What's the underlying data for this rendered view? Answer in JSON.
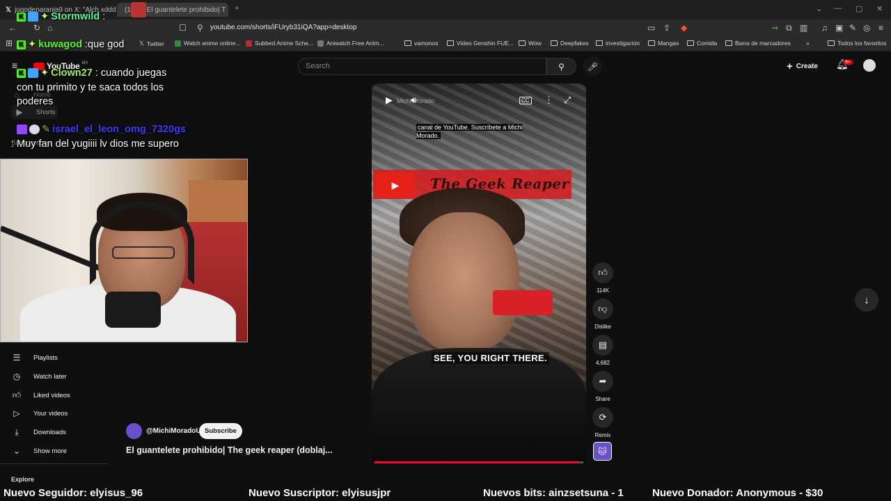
{
  "browser": {
    "tabs": [
      {
        "label": "jugodenaranja9 on X: \"Alch xddd ht",
        "icon": "x-logo-icon"
      },
      {
        "label": "(1093) El guantelete prohibido| T",
        "icon": "youtube-icon"
      }
    ],
    "url": "youtube.com/shorts/iFUryb31iQA?app=desktop",
    "bookmarks": [
      {
        "label": "Twitter",
        "icon": "x-logo-icon"
      },
      {
        "label": "Watch anime online...",
        "icon": "shield-icon"
      },
      {
        "label": "Subbed Anime Sche...",
        "icon": "a-logo-icon"
      },
      {
        "label": "Aniwatch Free Anim...",
        "icon": "aniwatch-icon"
      },
      {
        "label": "vamonos",
        "icon": "folder-icon"
      },
      {
        "label": "Video Genshin FUE...",
        "icon": "folder-icon"
      },
      {
        "label": "Wow",
        "icon": "folder-icon"
      },
      {
        "label": "Deepfakes",
        "icon": "folder-icon"
      },
      {
        "label": "investigación",
        "icon": "folder-icon"
      },
      {
        "label": "Mangas",
        "icon": "folder-icon"
      },
      {
        "label": "Comida",
        "icon": "folder-icon"
      },
      {
        "label": "Barra de marcadores",
        "icon": "folder-icon"
      }
    ],
    "all_bookmarks": "Todos los favoritos"
  },
  "youtube": {
    "logo": "YouTube",
    "region": "MX",
    "search_placeholder": "Search",
    "create_label": "Create",
    "notifications_badge": "9+",
    "sidebar": {
      "top_items": [
        "Home",
        "Shorts",
        "Subscriptions"
      ],
      "items": [
        {
          "label": "Playlists",
          "icon": "playlists-icon"
        },
        {
          "label": "Watch later",
          "icon": "clock-icon"
        },
        {
          "label": "Liked videos",
          "icon": "thumbs-up-icon"
        },
        {
          "label": "Your videos",
          "icon": "play-square-icon"
        },
        {
          "label": "Downloads",
          "icon": "download-icon"
        },
        {
          "label": "Show more",
          "icon": "chevron-down-icon"
        }
      ],
      "explore_heading": "Explore"
    },
    "short": {
      "channel_ghost": "Michi Morado",
      "caption_top": "canal de YouTube. Suscríbete a Michi Morado.",
      "banner_title": "The Geek Reaper",
      "subtitle": "SEE, YOU RIGHT THERE.",
      "progress_fraction": 0.98,
      "channel_handle": "@MichiMoradoU",
      "subscribe_label": "Subscribe",
      "title": "El guantelete prohibido| The geek reaper (doblaj..."
    },
    "actions": [
      {
        "label": "114K",
        "icon": "thumbs-up-icon"
      },
      {
        "label": "Dislike",
        "icon": "thumbs-down-icon"
      },
      {
        "label": "4,682",
        "icon": "comment-icon"
      },
      {
        "label": "Share",
        "icon": "share-icon"
      },
      {
        "label": "Remix",
        "icon": "remix-icon"
      }
    ]
  },
  "stream_overlay": {
    "chat": [
      {
        "name": "Stormwild",
        "message": ":",
        "name_color": "#53fc98"
      },
      {
        "name": "kuwagod",
        "message": ":que god",
        "name_color": "#53fc18"
      },
      {
        "name": "Clown27",
        "message": ": cuando juegas",
        "name_color": "#9ef542"
      },
      {
        "name": "",
        "message": "con tu primito y te saca todos los",
        "name_color": "#ffffff"
      },
      {
        "name": "",
        "message": "poderes",
        "name_color": "#ffffff"
      },
      {
        "name": "israel_el_leon_omg_7320gs",
        "message": "",
        "name_color": "#3b3bff"
      },
      {
        "name": "",
        "message": ": Muy fan del yugiiii lv dios me supero",
        "name_color": "#ffffff"
      }
    ],
    "alerts": [
      "Nuevo Seguidor: elyisus_96",
      "Nuevo Suscriptor: elyisusjpr",
      "Nuevos bits: ainzsetsuna - 1",
      "Nuevo Donador: Anonymous - $30"
    ]
  },
  "colors": {
    "yt_red": "#ff0033",
    "bg": "#0f0f0f",
    "kick_green": "#53fc18"
  }
}
